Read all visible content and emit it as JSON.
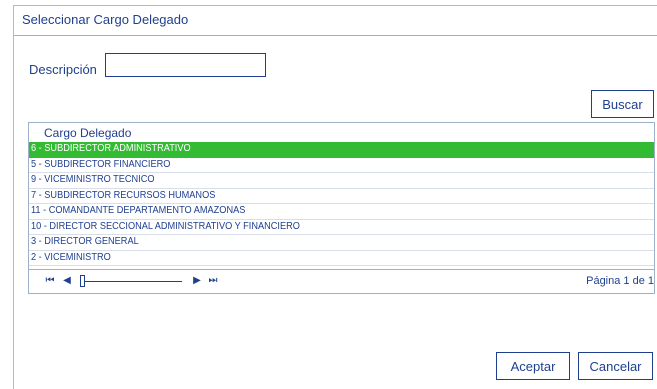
{
  "dialog": {
    "title": "Seleccionar Cargo Delegado"
  },
  "search": {
    "label": "Descripción",
    "value": "",
    "button": "Buscar"
  },
  "grid": {
    "header": "Cargo Delegado",
    "rows": [
      "6 - SUBDIRECTOR ADMINISTRATIVO",
      "5 - SUBDIRECTOR FINANCIERO",
      "9 - VICEMINISTRO TECNICO",
      "7 - SUBDIRECTOR RECURSOS HUMANOS",
      "11 - COMANDANTE DEPARTAMENTO AMAZONAS",
      "10 - DIRECTOR SECCIONAL ADMINISTRATIVO Y FINANCIERO",
      "3 - DIRECTOR GENERAL",
      "2 - VICEMINISTRO"
    ],
    "selected_index": 0
  },
  "pager": {
    "info": "Página 1 de 1"
  },
  "footer": {
    "accept": "Aceptar",
    "cancel": "Cancelar"
  },
  "colors": {
    "accent": "#1f3f8f",
    "selection": "#33bb33"
  }
}
